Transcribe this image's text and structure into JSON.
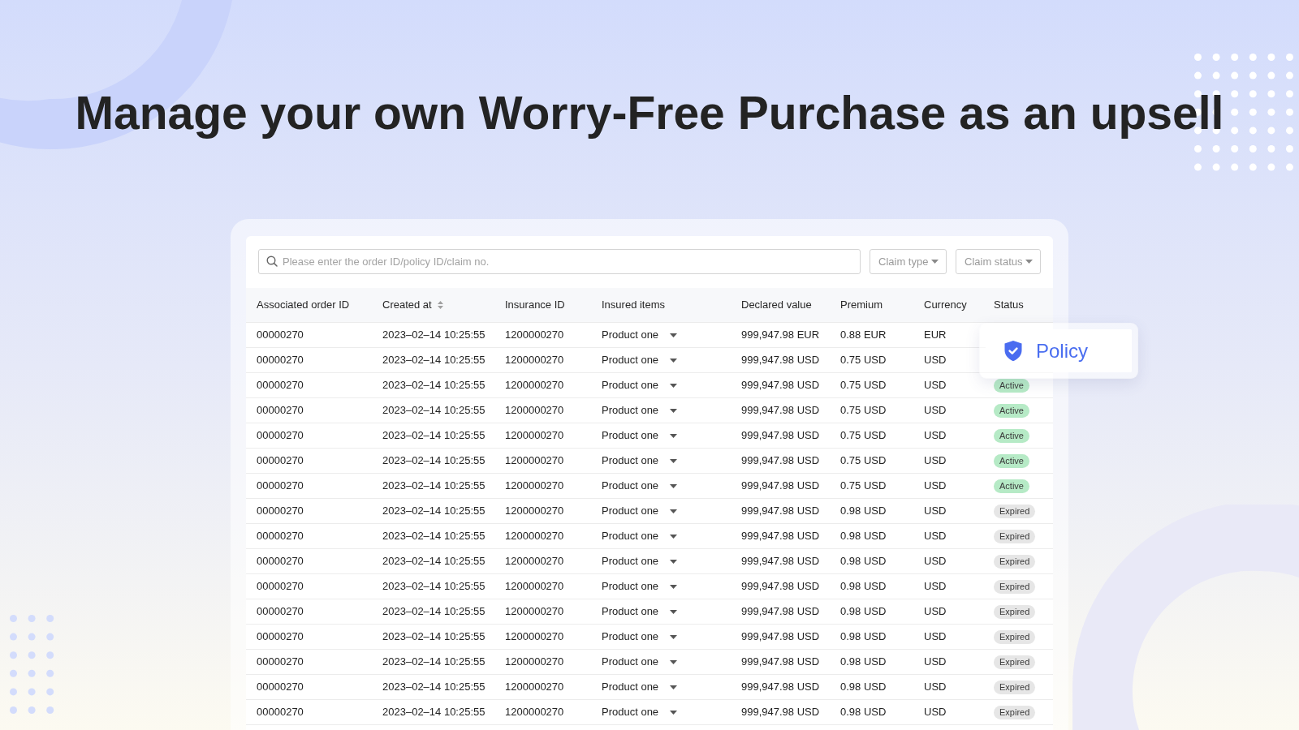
{
  "title": "Manage your own Worry-Free Purchase as an upsell",
  "search": {
    "placeholder": "Please enter the order ID/policy ID/claim no."
  },
  "filters": [
    {
      "label": "Claim type"
    },
    {
      "label": "Claim status"
    }
  ],
  "table": {
    "columns": [
      {
        "label": "Associated order ID",
        "kind": "text",
        "sortable": false
      },
      {
        "label": "Created at",
        "kind": "text",
        "sortable": true
      },
      {
        "label": "Insurance ID",
        "kind": "text",
        "sortable": false
      },
      {
        "label": "Insured items",
        "kind": "dropdown",
        "sortable": false
      },
      {
        "label": "Declared value",
        "kind": "text",
        "sortable": false
      },
      {
        "label": "Premium",
        "kind": "text",
        "sortable": false
      },
      {
        "label": "Currency",
        "kind": "text",
        "sortable": false
      },
      {
        "label": "Status",
        "kind": "status",
        "sortable": false
      }
    ],
    "rows": [
      {
        "cells": [
          "00000270",
          "2023–02–14 10:25:55",
          "1200000270",
          "Product one",
          "999,947.98 EUR",
          "0.88 EUR",
          "EUR"
        ]
      },
      {
        "cells": [
          "00000270",
          "2023–02–14 10:25:55",
          "1200000270",
          "Product one",
          "999,947.98 USD",
          "0.75 USD",
          "USD"
        ]
      },
      {
        "cells": [
          "00000270",
          "2023–02–14 10:25:55",
          "1200000270",
          "Product one",
          "999,947.98 USD",
          "0.75 USD",
          "USD"
        ],
        "status": {
          "label": "Active",
          "color": "#b6eac6"
        }
      },
      {
        "cells": [
          "00000270",
          "2023–02–14 10:25:55",
          "1200000270",
          "Product one",
          "999,947.98 USD",
          "0.75 USD",
          "USD"
        ],
        "status": {
          "label": "Active",
          "color": "#b6eac6"
        }
      },
      {
        "cells": [
          "00000270",
          "2023–02–14 10:25:55",
          "1200000270",
          "Product one",
          "999,947.98 USD",
          "0.75 USD",
          "USD"
        ],
        "status": {
          "label": "Active",
          "color": "#b6eac6"
        }
      },
      {
        "cells": [
          "00000270",
          "2023–02–14 10:25:55",
          "1200000270",
          "Product one",
          "999,947.98 USD",
          "0.75 USD",
          "USD"
        ],
        "status": {
          "label": "Active",
          "color": "#b6eac6"
        }
      },
      {
        "cells": [
          "00000270",
          "2023–02–14 10:25:55",
          "1200000270",
          "Product one",
          "999,947.98 USD",
          "0.75 USD",
          "USD"
        ],
        "status": {
          "label": "Active",
          "color": "#b6eac6"
        }
      },
      {
        "cells": [
          "00000270",
          "2023–02–14 10:25:55",
          "1200000270",
          "Product one",
          "999,947.98 USD",
          "0.98 USD",
          "USD"
        ],
        "status": {
          "label": "Expired",
          "color": "#e6e6e6"
        }
      },
      {
        "cells": [
          "00000270",
          "2023–02–14 10:25:55",
          "1200000270",
          "Product one",
          "999,947.98 USD",
          "0.98 USD",
          "USD"
        ],
        "status": {
          "label": "Expired",
          "color": "#e6e6e6"
        }
      },
      {
        "cells": [
          "00000270",
          "2023–02–14 10:25:55",
          "1200000270",
          "Product one",
          "999,947.98 USD",
          "0.98 USD",
          "USD"
        ],
        "status": {
          "label": "Expired",
          "color": "#e6e6e6"
        }
      },
      {
        "cells": [
          "00000270",
          "2023–02–14 10:25:55",
          "1200000270",
          "Product one",
          "999,947.98 USD",
          "0.98 USD",
          "USD"
        ],
        "status": {
          "label": "Expired",
          "color": "#e6e6e6"
        }
      },
      {
        "cells": [
          "00000270",
          "2023–02–14 10:25:55",
          "1200000270",
          "Product one",
          "999,947.98 USD",
          "0.98 USD",
          "USD"
        ],
        "status": {
          "label": "Expired",
          "color": "#e6e6e6"
        }
      },
      {
        "cells": [
          "00000270",
          "2023–02–14 10:25:55",
          "1200000270",
          "Product one",
          "999,947.98 USD",
          "0.98 USD",
          "USD"
        ],
        "status": {
          "label": "Expired",
          "color": "#e6e6e6"
        }
      },
      {
        "cells": [
          "00000270",
          "2023–02–14 10:25:55",
          "1200000270",
          "Product one",
          "999,947.98 USD",
          "0.98 USD",
          "USD"
        ],
        "status": {
          "label": "Expired",
          "color": "#e6e6e6"
        }
      },
      {
        "cells": [
          "00000270",
          "2023–02–14 10:25:55",
          "1200000270",
          "Product one",
          "999,947.98 USD",
          "0.98 USD",
          "USD"
        ],
        "status": {
          "label": "Expired",
          "color": "#e6e6e6"
        }
      },
      {
        "cells": [
          "00000270",
          "2023–02–14 10:25:55",
          "1200000270",
          "Product one",
          "999,947.98 USD",
          "0.98 USD",
          "USD"
        ],
        "status": {
          "label": "Expired",
          "color": "#e6e6e6"
        }
      }
    ]
  },
  "popup": {
    "label": "Policy"
  }
}
